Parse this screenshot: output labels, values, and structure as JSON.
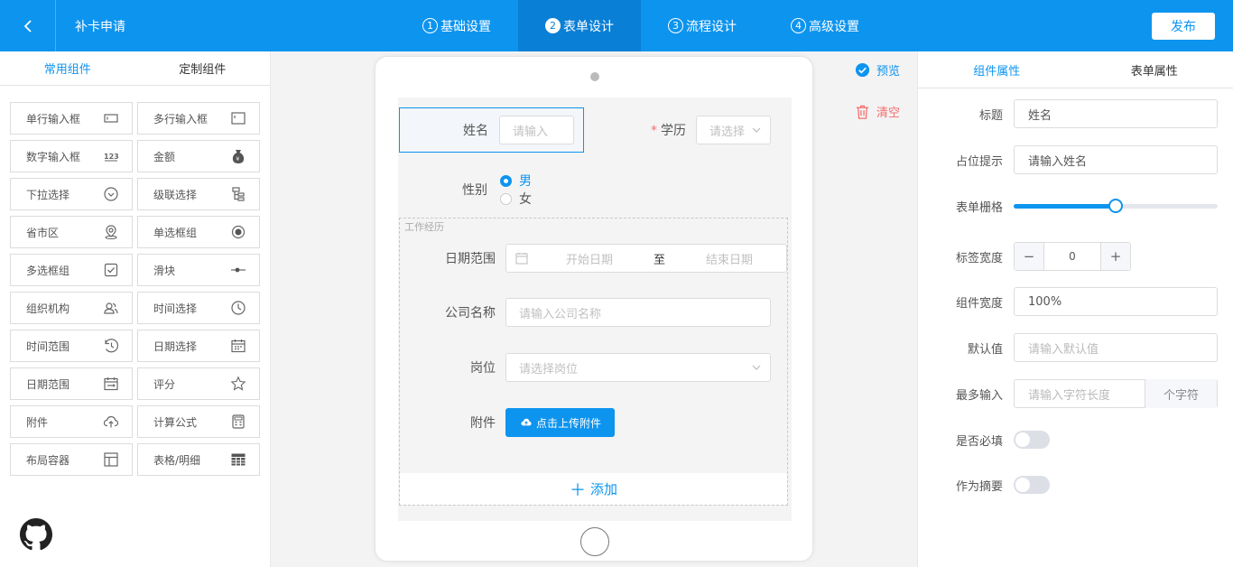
{
  "header": {
    "title": "补卡申请",
    "steps": [
      {
        "num": "1",
        "label": "基础设置"
      },
      {
        "num": "2",
        "label": "表单设计"
      },
      {
        "num": "3",
        "label": "流程设计"
      },
      {
        "num": "4",
        "label": "高级设置"
      }
    ],
    "publish_label": "发布"
  },
  "left_panel": {
    "tabs": [
      "常用组件",
      "定制组件"
    ],
    "components": [
      "单行输入框",
      "多行输入框",
      "数字输入框",
      "金额",
      "下拉选择",
      "级联选择",
      "省市区",
      "单选框组",
      "多选框组",
      "滑块",
      "组织机构",
      "时间选择",
      "时间范围",
      "日期选择",
      "日期范围",
      "评分",
      "附件",
      "计算公式",
      "布局容器",
      "表格/明细"
    ]
  },
  "canvas": {
    "preview_label": "预览",
    "clear_label": "清空",
    "form": {
      "name_label": "姓名",
      "name_placeholder": "请输入",
      "education_label": "学历",
      "education_placeholder": "请选择",
      "gender_label": "性别",
      "gender_options": [
        "男",
        "女"
      ],
      "group_title": "工作经历",
      "date_range_label": "日期范围",
      "start_placeholder": "开始日期",
      "range_separator": "至",
      "end_placeholder": "结束日期",
      "company_label": "公司名称",
      "company_placeholder": "请输入公司名称",
      "position_label": "岗位",
      "position_placeholder": "请选择岗位",
      "attachment_label": "附件",
      "upload_label": "点击上传附件",
      "add_label": "添加"
    }
  },
  "right_panel": {
    "tabs": [
      "组件属性",
      "表单属性"
    ],
    "title_label": "标题",
    "title_value": "姓名",
    "placeholder_label": "占位提示",
    "placeholder_value": "请输入姓名",
    "grid_label": "表单栅格",
    "grid_fraction": 0.5,
    "label_width_label": "标签宽度",
    "label_width_value": "0",
    "component_width_label": "组件宽度",
    "component_width_value": "100%",
    "default_label": "默认值",
    "default_placeholder": "请输入默认值",
    "max_input_label": "最多输入",
    "max_input_placeholder": "请输入字符长度",
    "max_input_suffix": "个字符",
    "required_label": "是否必填",
    "summary_label": "作为摘要"
  },
  "colors": {
    "primary": "#0d94ef",
    "danger": "#f56c6c"
  }
}
